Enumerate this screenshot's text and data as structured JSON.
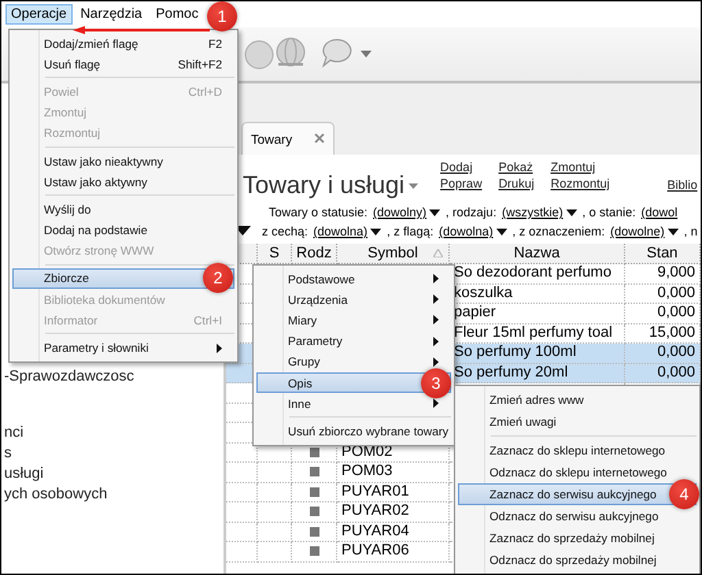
{
  "menubar": [
    {
      "label": "Operacje",
      "selected": true
    },
    {
      "label": "Narzędzia",
      "selected": false
    },
    {
      "label": "Pomoc",
      "selected": false
    }
  ],
  "sidebar": {
    "items": [
      "-Sprawozdawczosc",
      "nci",
      "s",
      "usługi",
      "ych osobowych"
    ]
  },
  "tabs": [
    {
      "label": "Towary",
      "selected": true
    }
  ],
  "heading": "Towary i usługi",
  "actions": [
    [
      "Dodaj",
      "Popraw"
    ],
    [
      "Pokaż",
      "Drukuj"
    ],
    [
      "Zmontuj",
      "Rozmontuj"
    ],
    [
      "Biblio"
    ]
  ],
  "filters": [
    [
      {
        "label": "Towary o statusie:",
        "value": "(dowolny)",
        "dropdown": true
      },
      {
        "label": ", rodzaju:",
        "value": "(wszystkie)",
        "dropdown": true
      },
      {
        "label": ", o stanie:",
        "value": "(dowol",
        "dropdown": false
      }
    ],
    [
      {
        "label": "z cechą:",
        "value": "(dowolna)",
        "dropdown": true
      },
      {
        "label": ", z flagą:",
        "value": "(dowolna)",
        "dropdown": true
      },
      {
        "label": ", z oznaczeniem:",
        "value": "(dowolne)",
        "dropdown": true
      },
      {
        "label": ", n"
      }
    ]
  ],
  "table": {
    "columns": [
      "",
      "S",
      "Rodz",
      "Symbol",
      "Nazwa",
      "Stan"
    ],
    "rows": [
      {
        "symbol": "",
        "nazwa": "So dezodorant perfumo",
        "stan": "9,000",
        "selected": false
      },
      {
        "symbol": "",
        "nazwa": "koszulka",
        "stan": "0,000",
        "selected": false
      },
      {
        "symbol": "",
        "nazwa": "papier",
        "stan": "0,000",
        "selected": false
      },
      {
        "symbol": "",
        "nazwa": "Fleur 15ml perfumy toal",
        "stan": "15,000",
        "selected": false
      },
      {
        "symbol": "",
        "nazwa": "So perfumy 100ml",
        "stan": "0,000",
        "selected": true
      },
      {
        "symbol": "",
        "nazwa": "So perfumy 20ml",
        "stan": "0,000",
        "selected": true
      },
      {
        "symbol": "",
        "nazwa": "",
        "stan": "",
        "selected": false
      },
      {
        "symbol": "",
        "nazwa": "",
        "stan": "",
        "selected": false
      },
      {
        "symbol": "",
        "nazwa": "",
        "stan": "",
        "selected": false
      },
      {
        "symbol": "POM02",
        "nazwa": "",
        "stan": "",
        "icon": true,
        "selected": false
      },
      {
        "symbol": "POM03",
        "nazwa": "",
        "stan": "",
        "icon": true,
        "selected": false
      },
      {
        "symbol": "PUYAR01",
        "nazwa": "",
        "stan": "",
        "icon": true,
        "selected": false
      },
      {
        "symbol": "PUYAR02",
        "nazwa": "",
        "stan": "",
        "icon": true,
        "selected": false
      },
      {
        "symbol": "PUYAR04",
        "nazwa": "",
        "stan": "",
        "icon": true,
        "selected": false
      },
      {
        "symbol": "PUYAR06",
        "nazwa": "",
        "stan": "",
        "icon": true,
        "selected": false
      }
    ]
  },
  "menus": [
    {
      "badge": "2",
      "items": [
        {
          "kind": "item",
          "label": "Dodaj/zmień flagę",
          "shortcut": "F2",
          "disabled": false,
          "selected": false
        },
        {
          "kind": "item",
          "label": "Usuń flagę",
          "shortcut": "Shift+F2",
          "disabled": false,
          "selected": false
        },
        {
          "kind": "separator"
        },
        {
          "kind": "item",
          "label": "Powiel",
          "shortcut": "Ctrl+D",
          "disabled": true,
          "selected": false
        },
        {
          "kind": "item",
          "label": "Zmontuj",
          "disabled": true,
          "selected": false
        },
        {
          "kind": "item",
          "label": "Rozmontuj",
          "disabled": true,
          "selected": false
        },
        {
          "kind": "separator"
        },
        {
          "kind": "item",
          "label": "Ustaw jako nieaktywny",
          "disabled": false,
          "selected": false
        },
        {
          "kind": "item",
          "label": "Ustaw jako aktywny",
          "disabled": false,
          "selected": false
        },
        {
          "kind": "separator"
        },
        {
          "kind": "item",
          "label": "Wyślij do",
          "disabled": false,
          "selected": false
        },
        {
          "kind": "item",
          "label": "Dodaj na podstawie",
          "disabled": false,
          "selected": false
        },
        {
          "kind": "item",
          "label": "Otwórz stronę WWW",
          "disabled": true,
          "selected": false
        },
        {
          "kind": "separator"
        },
        {
          "kind": "item",
          "label": "Zbiorcze",
          "disabled": false,
          "selected": true
        },
        {
          "kind": "item",
          "label": "Biblioteka dokumentów",
          "disabled": true,
          "selected": false
        },
        {
          "kind": "item",
          "label": "Informator",
          "shortcut": "Ctrl+I",
          "disabled": true,
          "selected": false
        },
        {
          "kind": "separator"
        },
        {
          "kind": "submenu",
          "label": "Parametry i słowniki",
          "disabled": false,
          "selected": false
        }
      ]
    },
    {
      "badge": "3",
      "items": [
        {
          "kind": "submenu",
          "label": "Podstawowe",
          "disabled": false,
          "selected": false
        },
        {
          "kind": "submenu",
          "label": "Urządzenia",
          "disabled": false,
          "selected": false
        },
        {
          "kind": "submenu",
          "label": "Miary",
          "disabled": false,
          "selected": false
        },
        {
          "kind": "submenu",
          "label": "Parametry",
          "disabled": false,
          "selected": false
        },
        {
          "kind": "submenu",
          "label": "Grupy",
          "disabled": false,
          "selected": false
        },
        {
          "kind": "item",
          "label": "Opis",
          "disabled": false,
          "selected": true
        },
        {
          "kind": "submenu",
          "label": "Inne",
          "disabled": false,
          "selected": false
        },
        {
          "kind": "separator"
        },
        {
          "kind": "item",
          "label": "Usuń zbiorczo wybrane towary",
          "disabled": false,
          "selected": false
        }
      ]
    },
    {
      "badge": "4",
      "items": [
        {
          "kind": "item",
          "label": "Zmień adres www",
          "disabled": false,
          "selected": false
        },
        {
          "kind": "item",
          "label": "Zmień uwagi",
          "disabled": false,
          "selected": false
        },
        {
          "kind": "separator"
        },
        {
          "kind": "item",
          "label": "Zaznacz do sklepu internetowego",
          "disabled": false,
          "selected": false
        },
        {
          "kind": "item",
          "label": "Odznacz do sklepu internetowego",
          "disabled": false,
          "selected": false
        },
        {
          "kind": "item",
          "label": "Zaznacz do serwisu aukcyjnego",
          "disabled": false,
          "selected": true
        },
        {
          "kind": "item",
          "label": "Odznacz do serwisu aukcyjnego",
          "disabled": false,
          "selected": false
        },
        {
          "kind": "item",
          "label": "Zaznacz do sprzedaży mobilnej",
          "disabled": false,
          "selected": false
        },
        {
          "kind": "item",
          "label": "Odznacz do sprzedaży mobilnej",
          "disabled": false,
          "selected": false
        }
      ]
    }
  ],
  "callout": "1"
}
